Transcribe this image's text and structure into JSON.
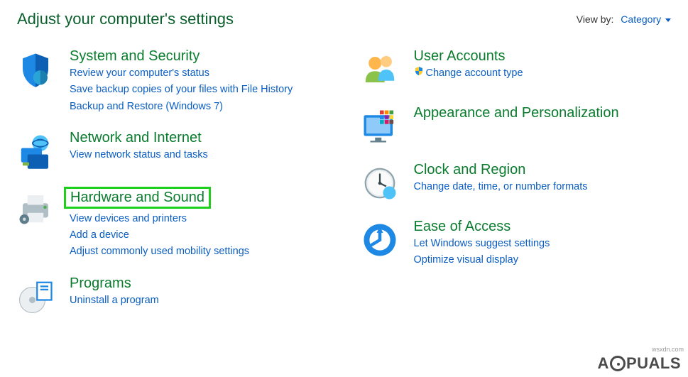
{
  "header": {
    "title": "Adjust your computer's settings",
    "view_by_label": "View by:",
    "view_by_value": "Category"
  },
  "left": [
    {
      "title": "System and Security",
      "links": [
        "Review your computer's status",
        "Save backup copies of your files with File History",
        "Backup and Restore (Windows 7)"
      ]
    },
    {
      "title": "Network and Internet",
      "links": [
        "View network status and tasks"
      ]
    },
    {
      "title": "Hardware and Sound",
      "highlighted": true,
      "links": [
        "View devices and printers",
        "Add a device",
        "Adjust commonly used mobility settings"
      ]
    },
    {
      "title": "Programs",
      "links": [
        "Uninstall a program"
      ]
    }
  ],
  "right": [
    {
      "title": "User Accounts",
      "links": [
        "Change account type"
      ],
      "shield_on_first": true
    },
    {
      "title": "Appearance and Personalization",
      "links": []
    },
    {
      "title": "Clock and Region",
      "links": [
        "Change date, time, or number formats"
      ]
    },
    {
      "title": "Ease of Access",
      "links": [
        "Let Windows suggest settings",
        "Optimize visual display"
      ]
    }
  ],
  "watermark": {
    "pre": "A",
    "post": "PUALS"
  },
  "src_note": "wsxdn.com"
}
